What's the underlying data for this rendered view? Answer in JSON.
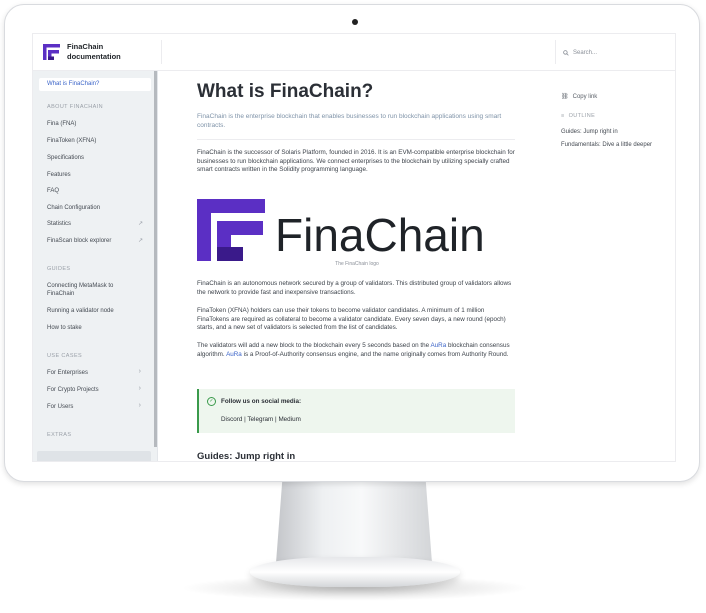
{
  "brand": {
    "name": "FinaChain documentation",
    "purple": "#5b2fc4",
    "dark_purple": "#3a1a8a"
  },
  "header": {
    "search_placeholder": "Search..."
  },
  "sidebar": {
    "active_item": "What is FinaChain?",
    "sections": [
      {
        "title": "ABOUT FINACHAIN",
        "items": [
          {
            "label": "Fina (FNA)"
          },
          {
            "label": "FinaToken (XFNA)"
          },
          {
            "label": "Specifications"
          },
          {
            "label": "Features"
          },
          {
            "label": "FAQ"
          },
          {
            "label": "Chain Configuration"
          },
          {
            "label": "Statistics",
            "icon": "external-link-icon"
          },
          {
            "label": "FinaScan block explorer",
            "icon": "external-link-icon"
          }
        ]
      },
      {
        "title": "GUIDES",
        "items": [
          {
            "label": "Connecting MetaMask to FinaChain"
          },
          {
            "label": "Running a validator node"
          },
          {
            "label": "How to stake"
          }
        ]
      },
      {
        "title": "USE CASES",
        "items": [
          {
            "label": "For Enterprises",
            "icon": "chevron-right-icon"
          },
          {
            "label": "For Crypto Projects",
            "icon": "chevron-right-icon"
          },
          {
            "label": "For Users",
            "icon": "chevron-right-icon"
          }
        ]
      },
      {
        "title": "EXTRAS",
        "items": []
      }
    ]
  },
  "main": {
    "title": "What is FinaChain?",
    "subtitle": "FinaChain is the enterprise blockchain that enables businesses to run blockchain applications using smart contracts.",
    "para1": "FinaChain is the successor of Solaris Platform, founded in 2016. It is an EVM-compatible enterprise blockchain for businesses to run blockchain applications. We connect enterprises to the blockchain by utilizing specially crafted smart contracts written in the Solidity programming language.",
    "logo_wordmark": "FinaChain",
    "logo_caption": "The FinaChain logo",
    "para2": "FinaChain is an autonomous network secured by a group of validators. This distributed group of validators allows the network to provide fast and inexpensive transactions.",
    "para3": "FinaToken (XFNA) holders can use their tokens to become validator candidates. A minimum of 1 million FinaTokens are required as collateral to become a validator candidate. Every seven days, a new round (epoch) starts, and a new set of validators is selected from the list of candidates.",
    "para4_a": "The validators will add a new block to the blockchain every 5 seconds based on the ",
    "para4_link1": "AuRa",
    "para4_b": " blockchain consensus algorithm. ",
    "para4_link2": "AuRa",
    "para4_c": " is a Proof-of-Authority consensus engine, and the name originally comes from Authority Round.",
    "callout_title": "Follow us on social media:",
    "social_discord": "Discord",
    "social_telegram": "Telegram",
    "social_medium": "Medium",
    "social_sep": "|",
    "section_heading": "Guides: Jump right in"
  },
  "rail": {
    "copy_link": "Copy link",
    "outline_heading": "OUTLINE",
    "outline_items": [
      "Guides: Jump right in",
      "Fundamentals: Dive a little deeper"
    ]
  }
}
